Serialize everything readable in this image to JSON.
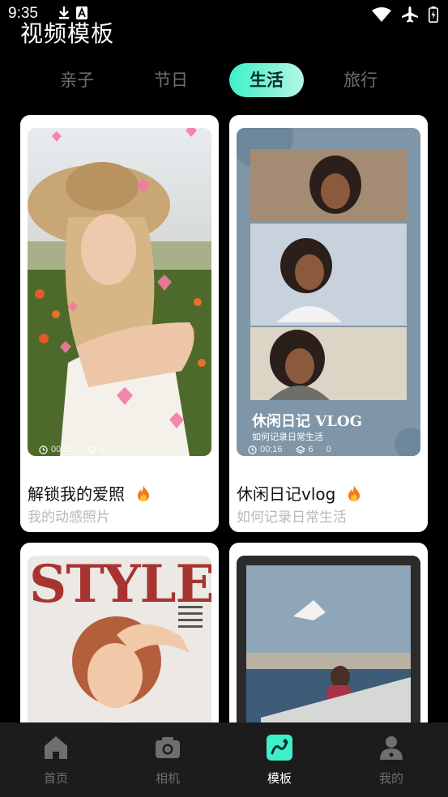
{
  "status_bar": {
    "time": "9:35"
  },
  "page_title": "视频模板",
  "tabs": [
    {
      "label": "亲子"
    },
    {
      "label": "节日"
    },
    {
      "label": "生活"
    },
    {
      "label": "旅行"
    }
  ],
  "active_tab": "生活",
  "cards": [
    {
      "title": "解锁我的爱照",
      "subtitle": "我的动感照片",
      "duration": "00:15",
      "layers": "2",
      "count": "0"
    },
    {
      "title": "休闲日记vlog",
      "subtitle": "如何记录日常生活",
      "overlay_title": "休闲日记 VLOG",
      "overlay_subtitle": "如何记录日常生活",
      "duration": "00:16",
      "layers": "6",
      "count": "0"
    },
    {
      "overlay_title": "STYLE"
    },
    {}
  ],
  "bottom_nav": [
    {
      "label": "首页",
      "icon": "home-icon"
    },
    {
      "label": "相机",
      "icon": "camera-icon"
    },
    {
      "label": "模板",
      "icon": "template-icon"
    },
    {
      "label": "我的",
      "icon": "profile-icon"
    }
  ],
  "active_nav": "模板",
  "colors": {
    "accent": "#3ef0c9",
    "background": "#000000",
    "nav_background": "#1c1c1c",
    "flame": "#f07a1a"
  }
}
